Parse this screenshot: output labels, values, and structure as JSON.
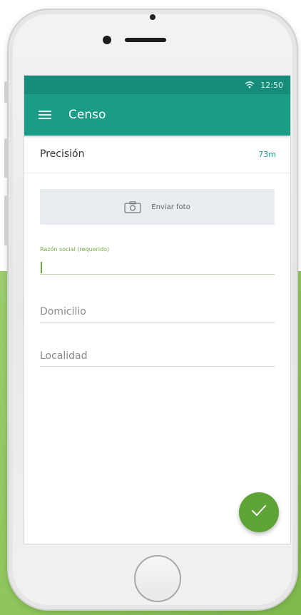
{
  "status_bar": {
    "time": "12:50",
    "wifi_icon": "wifi-icon"
  },
  "app_bar": {
    "title": "Censo",
    "menu_icon": "hamburger-menu-icon",
    "color": "#1a9c86"
  },
  "precision": {
    "label": "Precisión",
    "value": "73m"
  },
  "photo_button": {
    "label": "Enviar foto",
    "icon": "camera-icon"
  },
  "form": {
    "razon_social": {
      "label": "Razón social (requerido)",
      "value": ""
    },
    "domicilio": {
      "placeholder": "Domicilio",
      "value": ""
    },
    "localidad": {
      "placeholder": "Localidad",
      "value": ""
    }
  },
  "fab": {
    "icon": "check-icon",
    "color": "#5ea336"
  },
  "accent_colors": {
    "primary": "#1a9c86",
    "accent_green": "#6da940"
  }
}
